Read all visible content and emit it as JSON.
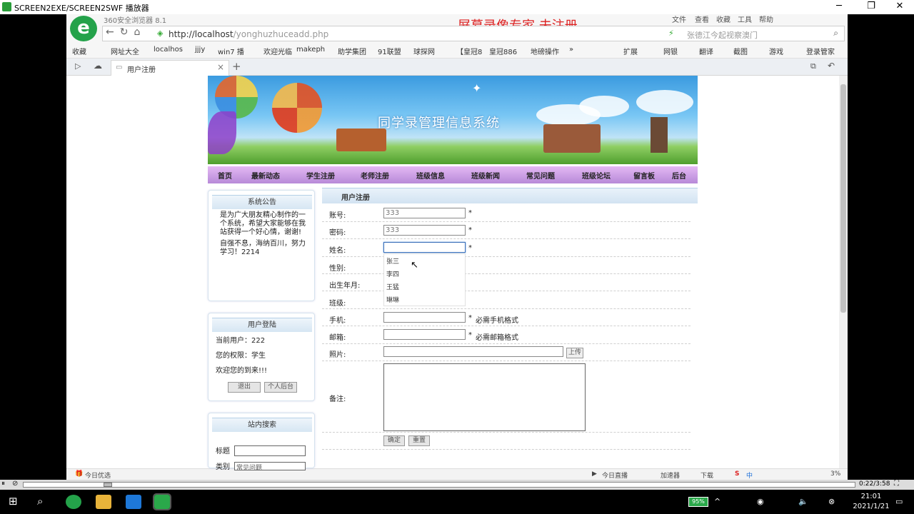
{
  "player": {
    "title": "SCREEN2EXE/SCREEN2SWF 播放器",
    "time": "0:22/3:58"
  },
  "browser": {
    "name": "360安全浏览器 8.1",
    "watermark": "屏幕录像专家  未注册",
    "menu": [
      "文件",
      "查看",
      "收藏",
      "工具",
      "帮助"
    ],
    "url_host": "http://localhost",
    "url_path": "/yonghuzhuceadd.php",
    "search_text": "张德江今起视察澳门",
    "favorites": [
      "收藏",
      "网址大全",
      "localhos",
      "jjjy",
      "win7 播",
      "欢迎光临",
      "makeph",
      "助学集团",
      "91联盟",
      "球探网",
      "【皇冠8",
      "皇冠886",
      "地磅操作",
      "»"
    ],
    "toolbar_right": [
      "扩展",
      "网银",
      "翻译",
      "截图",
      "游戏",
      "登录管家"
    ],
    "tab_label": "用户注册",
    "status_left": "今日优选",
    "status_right": [
      "今日直播",
      "加速器",
      "下载",
      "中",
      "3%"
    ]
  },
  "site": {
    "banner_title": "同学录管理信息系统",
    "nav": [
      "首页",
      "最新动态",
      "学生注册",
      "老师注册",
      "班级信息",
      "班级新闻",
      "常见问题",
      "班级论坛",
      "留言板",
      "后台"
    ],
    "notice": {
      "title": "系统公告",
      "line1": "是为广大朋友精心制作的一个系统，希望大家能够在我站获得一个好心情，谢谢!",
      "line2": "自强不息，海纳百川，努力学习！2214"
    },
    "login": {
      "title": "用户登陆",
      "current_user": "当前用户：222",
      "role": "您的权限：学生",
      "welcome": "欢迎您的到来!!!",
      "logout": "退出",
      "personal": "个人后台"
    },
    "search": {
      "title": "站内搜索",
      "label": "标题",
      "label2": "类别",
      "select_value": "常见问题"
    }
  },
  "form": {
    "header": "用户注册",
    "fields": {
      "account_label": "账号:",
      "account_value": "333",
      "password_label": "密码:",
      "password_value": "333",
      "name_label": "姓名:",
      "gender_label": "性别:",
      "birth_label": "出生年月:",
      "class_label": "班级:",
      "phone_label": "手机:",
      "phone_hint": "必需手机格式",
      "email_label": "邮箱:",
      "email_hint": "必需邮箱格式",
      "photo_label": "照片:",
      "upload": "上传",
      "remark_label": "备注:",
      "star": "*"
    },
    "autocomplete": [
      "张三",
      "李四",
      "王猛",
      "琳琳"
    ],
    "submit": "确定",
    "reset": "重置"
  },
  "taskbar": {
    "battery": "95%",
    "time": "21:01",
    "date": "2021/1/21"
  }
}
